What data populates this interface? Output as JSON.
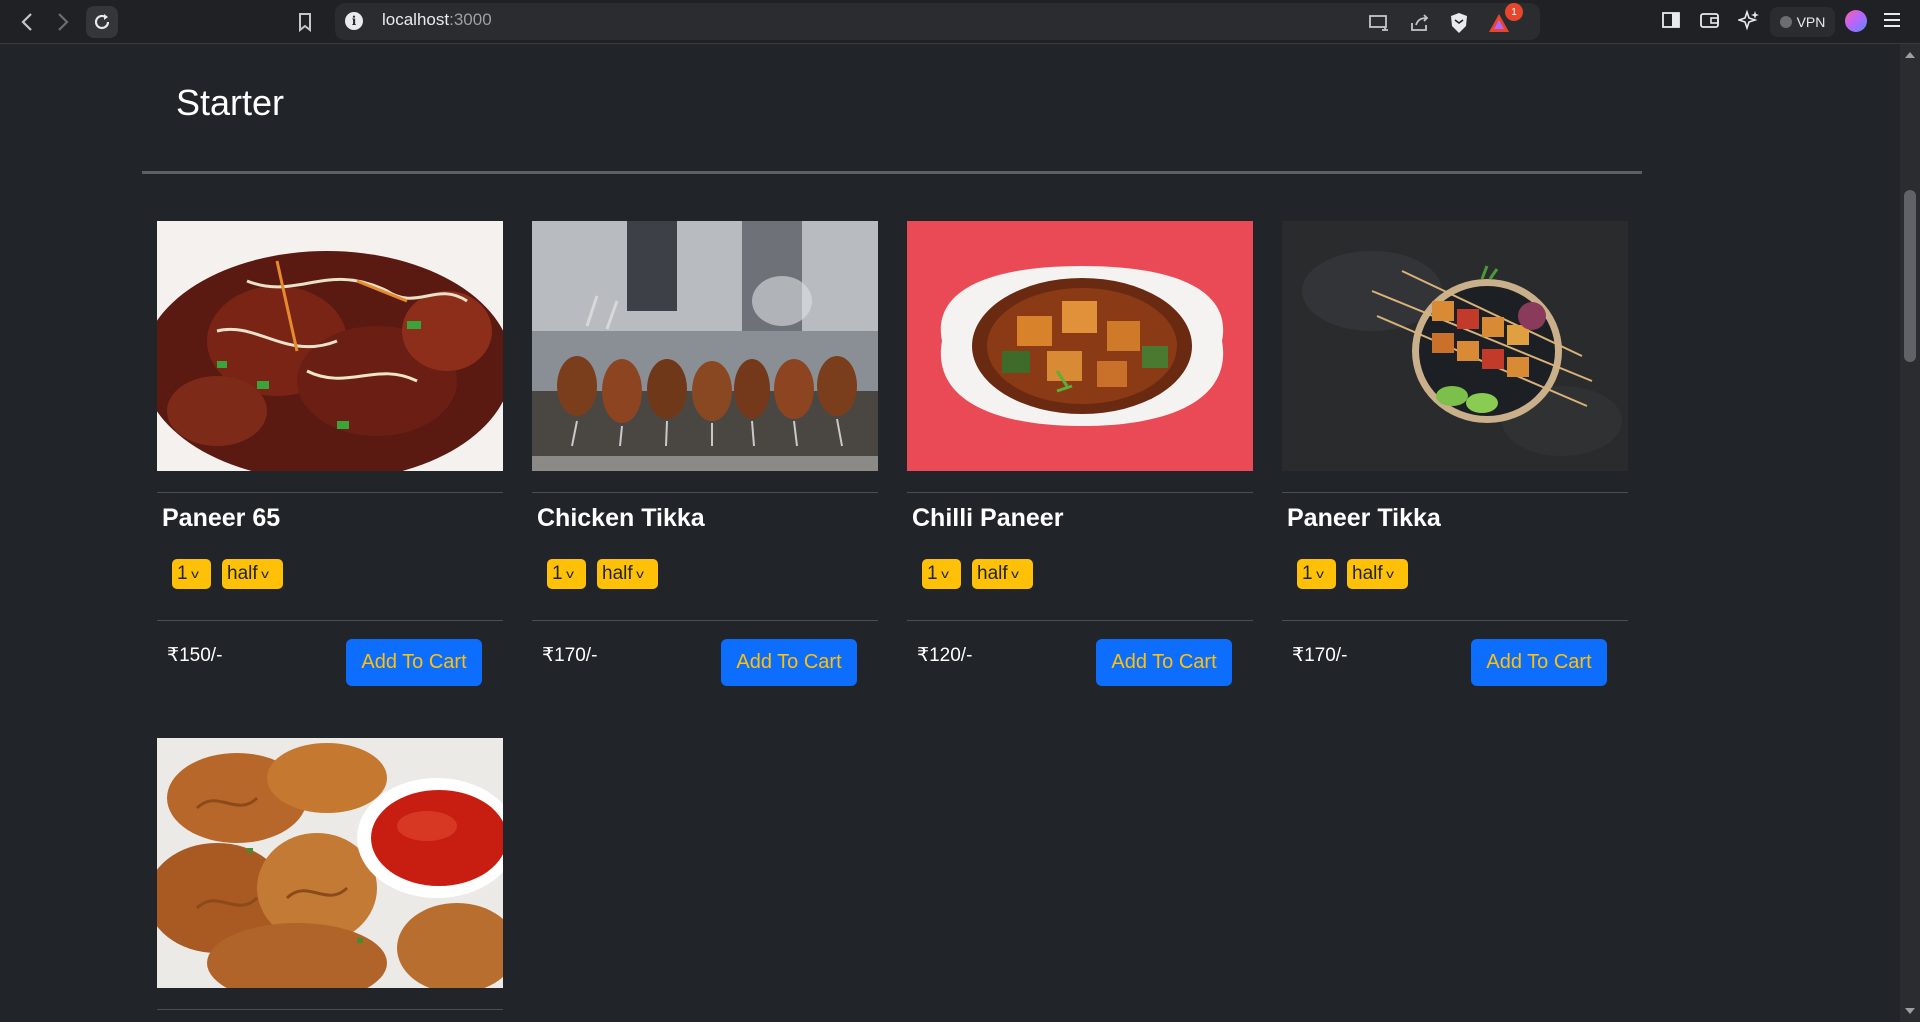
{
  "browser": {
    "url_host": "localhost",
    "url_port": ":3000",
    "notification_badge": "1",
    "vpn_label": "VPN"
  },
  "section": {
    "title": "Starter"
  },
  "items": [
    {
      "name": "Paneer 65",
      "qty": "1",
      "size": "half",
      "price": "₹150/-",
      "button": "Add To Cart"
    },
    {
      "name": "Chicken Tikka",
      "qty": "1",
      "size": "half",
      "price": "₹170/-",
      "button": "Add To Cart"
    },
    {
      "name": "Chilli Paneer",
      "qty": "1",
      "size": "half",
      "price": "₹120/-",
      "button": "Add To Cart"
    },
    {
      "name": "Paneer Tikka",
      "qty": "1",
      "size": "half",
      "price": "₹170/-",
      "button": "Add To Cart"
    }
  ],
  "colors": {
    "page_bg": "#212529",
    "select_bg": "#ffc107",
    "button_bg": "#0d6efd",
    "button_text": "#ffc107"
  }
}
